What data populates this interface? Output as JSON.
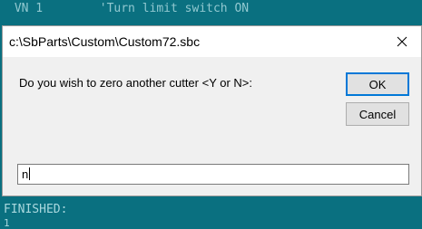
{
  "console": {
    "top_line": " VN 1        'Turn limit switch ON",
    "bottom_line": "FINISHED:",
    "cursor_line": "1"
  },
  "dialog": {
    "title": "c:\\SbParts\\Custom\\Custom72.sbc",
    "prompt": "Do you wish to zero another cutter <Y or N>:",
    "ok_label": "OK",
    "cancel_label": "Cancel",
    "input_value": "n"
  }
}
